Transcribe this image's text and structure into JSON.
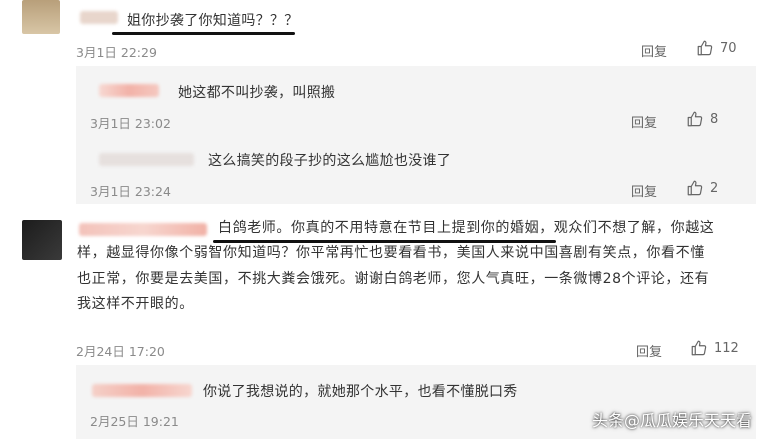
{
  "comments": [
    {
      "text": "姐你抄袭了你知道吗？？？",
      "date": "3月1日 22:29",
      "reply_label": "回复",
      "likes": "70",
      "replies": [
        {
          "text": "她这都不叫抄袭，叫照搬",
          "date": "3月1日 23:02",
          "reply_label": "回复",
          "likes": "8"
        },
        {
          "text": "这么搞笑的段子抄的这么尴尬也没谁了",
          "date": "3月1日 23:24",
          "reply_label": "回复",
          "likes": "2"
        }
      ]
    },
    {
      "lines": [
        "白鸽老师。你真的不用特意在节目上提到你的婚姻，观众们不想了解，你越这",
        "样，越显得你像个弱智你知道吗？你平常再忙也要看看书，美国人来说中国喜剧有笑点，你看不懂",
        "也正常，你要是去美国，不挑大粪会饿死。谢谢白鸽老师，您人气真旺，一条微博28个评论，还有",
        "我这样不开眼的。"
      ],
      "date": "2月24日 17:20",
      "reply_label": "回复",
      "likes": "112",
      "replies": [
        {
          "text": "你说了我想说的，就她那个水平，也看不懂脱口秀",
          "date": "2月25日 19:21"
        }
      ]
    }
  ],
  "watermark": "头条@瓜瓜娱乐天天看",
  "colors": {
    "accent": "#111111",
    "blur_pink": "#f2b2a8"
  }
}
